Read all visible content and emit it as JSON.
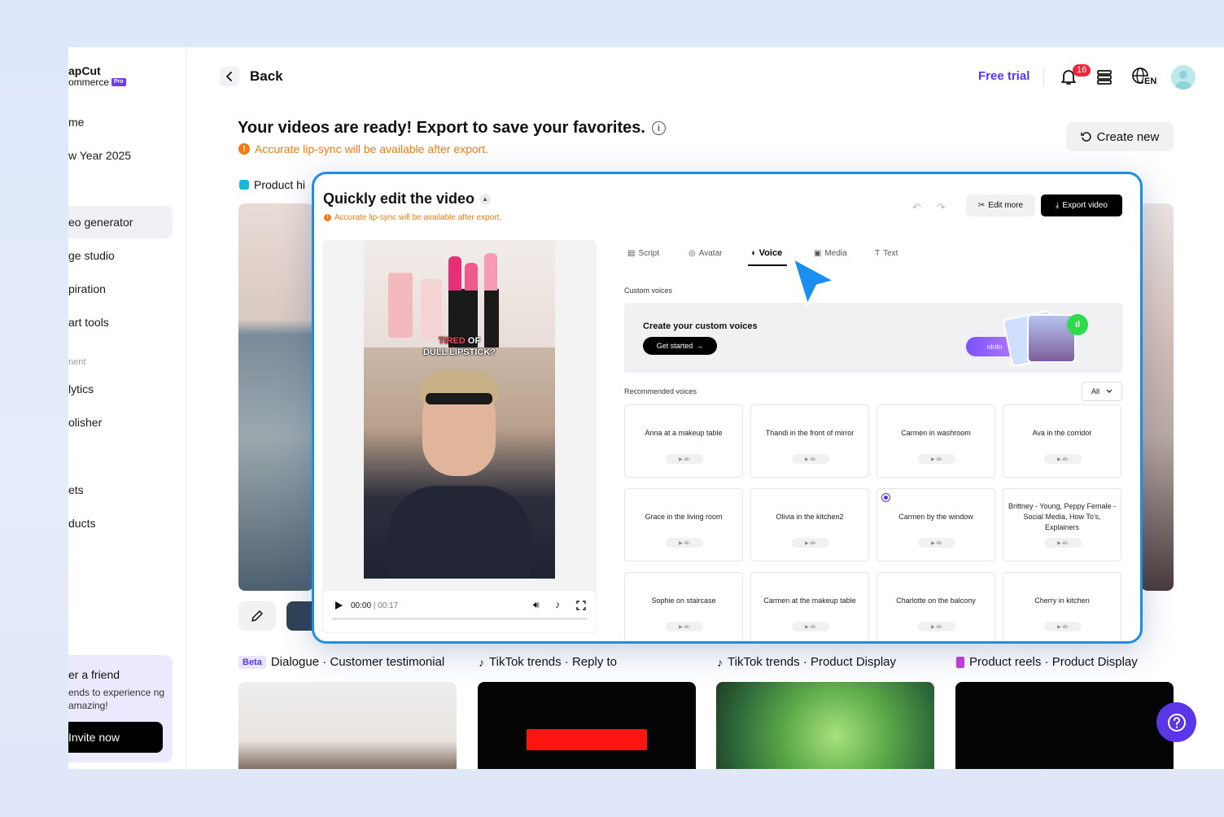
{
  "sidebar": {
    "logo_line1": "apCut",
    "logo_line2": "ommerce",
    "logo_badge": "Pro",
    "items": [
      {
        "label": "me"
      },
      {
        "label": "w Year 2025"
      },
      {
        "label": "eo generator"
      },
      {
        "label": "ge studio"
      },
      {
        "label": "piration"
      },
      {
        "label": "art tools"
      },
      {
        "label": "lytics"
      },
      {
        "label": "olisher"
      },
      {
        "label": "ets"
      },
      {
        "label": "ducts"
      }
    ],
    "section_label": "nent",
    "invite": {
      "title": "er a friend",
      "desc": "ends to experience ng amazing!",
      "button": "Invite now"
    }
  },
  "header": {
    "back_label": "Back",
    "free_trial": "Free trial",
    "notif_count": "16",
    "lang": "EN"
  },
  "main": {
    "title": "Your videos are ready! Export to save your favorites.",
    "warning": "Accurate lip-sync will be available after export.",
    "create_new": "Create new",
    "section_label": "Product hi",
    "row2": [
      {
        "tag": "Beta",
        "label": "Dialogue · Customer testimonial"
      },
      {
        "tag": "",
        "label": "TikTok trends · Reply to"
      },
      {
        "tag": "",
        "label": "TikTok trends · Product Display"
      },
      {
        "tag": "",
        "label": "Product reels · Product Display"
      }
    ]
  },
  "modal": {
    "title": "Quickly edit the video",
    "warning": "Accurate lip-sync will be available after export.",
    "edit_more": "Edit more",
    "export_video": "Export video",
    "caption_red": "TIRED",
    "caption_rest": " OF",
    "caption_line2": "DULL LIPSTICK?",
    "time_current": "00:00",
    "time_total": "00:17",
    "tabs": [
      "Script",
      "Avatar",
      "Voice",
      "Media",
      "Text"
    ],
    "active_tab": "Voice",
    "custom_voices_label": "Custom voices",
    "banner_title": "Create your custom voices",
    "get_started": "Get started",
    "recommended_label": "Recommended voices",
    "filter": "All",
    "voices": [
      "Anna at a makeup table",
      "Thandi in the front of mirror",
      "Carmen in washroom",
      "Ava in the corridor",
      "Grace in the living room",
      "Olivia in the kitchen2",
      "Carmen by the window",
      "Brittney - Young, Peppy Female - Social Media, How To's, Explainers",
      "Sophie on staircase",
      "Carmen at the makeup table",
      "Charlotte on the balcony",
      "Cherry in kitchen"
    ],
    "selected_voice": "Carmen by the window"
  },
  "colors": {
    "accent": "#5b35e8",
    "warning": "#f07d14",
    "modal_border": "#1a8fe8"
  }
}
